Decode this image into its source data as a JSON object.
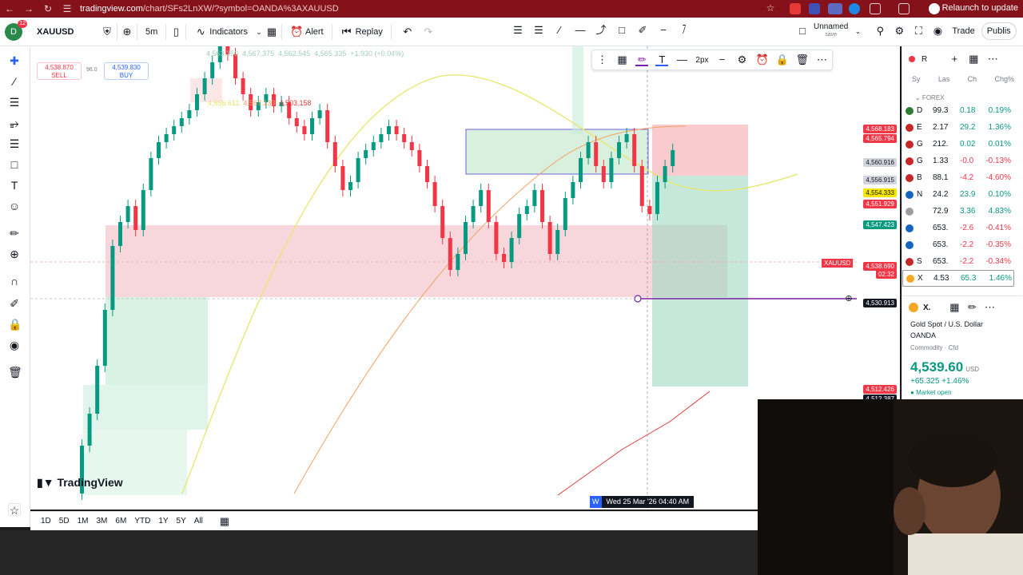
{
  "browser": {
    "url_host": "tradingview.com",
    "url_path": "/chart/SFs2LnXW/?symbol=OANDA%3AXAUUSD",
    "relaunch_label": "Relaunch to update"
  },
  "toolbar": {
    "avatar_letter": "D",
    "avatar_badge": "12",
    "symbol": "XAUUSD",
    "interval": "5m",
    "indicators_label": "Indicators",
    "alert_label": "Alert",
    "replay_label": "Replay",
    "layout_name": "Unnamed",
    "layout_sub": "save",
    "trade_label": "Trade",
    "publish_label": "Publis"
  },
  "legend": {
    "o": "4,563.350",
    "h": "4,567.375",
    "l": "4,562.545",
    "c": "4,565.335",
    "change": "+1.930 (+0.04%)",
    "indicator_vals": [
      "4,556.611",
      "4,567.133",
      "4,503.158"
    ]
  },
  "trade": {
    "sell_price": "4,538.870",
    "sell_label": "SELL",
    "spread": "96.0",
    "buy_price": "4,539.830",
    "buy_label": "BUY"
  },
  "drawing_toolbar": {
    "width_label": "2px"
  },
  "price_labels": [
    {
      "text": "4,568.183",
      "bg": "#f23645",
      "fg": "#ffffff"
    },
    {
      "text": "4,565.794",
      "bg": "#f23645",
      "fg": "#ffffff"
    },
    {
      "text": "4,560.916",
      "bg": "#d1d4dc",
      "fg": "#131722"
    },
    {
      "text": "4,556.915",
      "bg": "#d1d4dc",
      "fg": "#131722"
    },
    {
      "text": "4,554.333",
      "bg": "#f5e500",
      "fg": "#131722"
    },
    {
      "text": "4,551.929",
      "bg": "#f23645",
      "fg": "#ffffff"
    },
    {
      "text": "4,547.423",
      "bg": "#089981",
      "fg": "#ffffff"
    },
    {
      "text": "4,538.690",
      "bg": "#f23645",
      "fg": "#ffffff"
    },
    {
      "text": "02:32",
      "bg": "#f23645",
      "fg": "#ffffff"
    },
    {
      "text": "4,530.913",
      "bg": "#131722",
      "fg": "#ffffff"
    },
    {
      "text": "4,512.426",
      "bg": "#f23645",
      "fg": "#ffffff"
    },
    {
      "text": "4,512.387",
      "bg": "#131722",
      "fg": "#ffffff"
    }
  ],
  "symbol_tag": "XAUUSD",
  "time_axis": {
    "crosshair_day": "W",
    "crosshair_label": "Wed 25 Mar '26   04:40 AM"
  },
  "brand": "TradingView",
  "ranges": [
    "1D",
    "5D",
    "1M",
    "3M",
    "6M",
    "YTD",
    "1Y",
    "5Y",
    "All"
  ],
  "watchlist": {
    "title": "R",
    "columns": [
      "Sy",
      "Las",
      "Ch",
      "Chg%"
    ],
    "section": "FOREX",
    "rows": [
      {
        "sym": "D",
        "last": "99.3",
        "chg": "0.18",
        "pct": "0.19%",
        "dir": "pos",
        "color": "#2e7d32"
      },
      {
        "sym": "E",
        "last": "2.17",
        "chg": "29.2",
        "pct": "1.36%",
        "dir": "pos",
        "color": "#c62828"
      },
      {
        "sym": "G",
        "last": "212.",
        "chg": "0.02",
        "pct": "0.01%",
        "dir": "pos",
        "color": "#c62828"
      },
      {
        "sym": "G",
        "last": "1.33",
        "chg": "-0.0",
        "pct": "-0.13%",
        "dir": "neg",
        "color": "#c62828"
      },
      {
        "sym": "B",
        "last": "88.1",
        "chg": "-4.2",
        "pct": "-4.60%",
        "dir": "neg",
        "color": "#c62828"
      },
      {
        "sym": "N",
        "last": "24.2",
        "chg": "23.9",
        "pct": "0.10%",
        "dir": "pos",
        "color": "#1565c0"
      },
      {
        "sym": "",
        "last": "72.9",
        "chg": "3.36",
        "pct": "4.83%",
        "dir": "pos",
        "color": "#9e9e9e"
      },
      {
        "sym": "",
        "last": "653.",
        "chg": "-2.6",
        "pct": "-0.41%",
        "dir": "neg",
        "color": "#1565c0"
      },
      {
        "sym": "",
        "last": "653.",
        "chg": "-2.2",
        "pct": "-0.35%",
        "dir": "neg",
        "color": "#1565c0"
      },
      {
        "sym": "S",
        "last": "653.",
        "chg": "-2.2",
        "pct": "-0.34%",
        "dir": "neg",
        "color": "#c62828"
      },
      {
        "sym": "X",
        "last": "4.53",
        "chg": "65.3",
        "pct": "1.46%",
        "dir": "pos",
        "color": "#f5a623"
      }
    ]
  },
  "details": {
    "symbol": "X.",
    "name": "Gold Spot / U.S. Dollar",
    "exchange": "OANDA",
    "category": "Commodity · Cfd",
    "price": "4,539.60",
    "currency": "USD",
    "change": "+65.325 +1.46%",
    "status": "Market open"
  },
  "colors": {
    "bull": "#089981",
    "bear": "#f23645",
    "browser_red": "#85121b"
  }
}
